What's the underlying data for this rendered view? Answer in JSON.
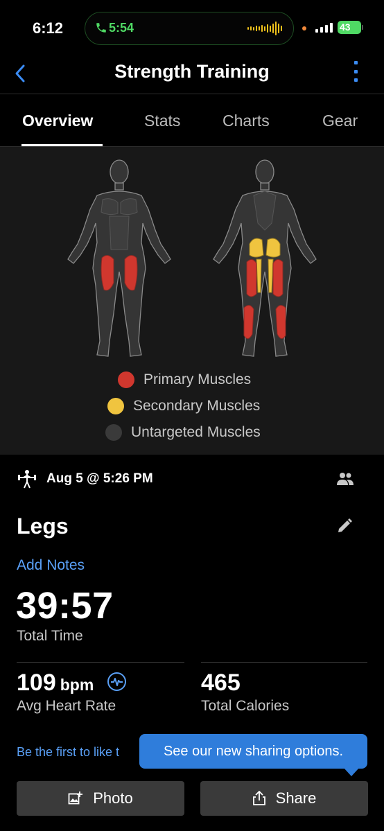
{
  "status_bar": {
    "time": "6:12",
    "call_time": "5:54",
    "battery": "43"
  },
  "nav": {
    "title": "Strength Training",
    "back_icon": "chevron-left-icon",
    "more_icon": "more-vertical-icon",
    "accent_color": "#3b8cf5"
  },
  "tabs": [
    {
      "label": "Overview",
      "active": true
    },
    {
      "label": "Stats",
      "active": false
    },
    {
      "label": "Charts",
      "active": false
    },
    {
      "label": "Gear",
      "active": false
    }
  ],
  "muscle_map": {
    "colors": {
      "primary": "#d0372e",
      "secondary": "#f0c43f",
      "untargeted": "#3a3a3a"
    },
    "legend": [
      {
        "label": "Primary Muscles",
        "color": "#d0372e"
      },
      {
        "label": "Secondary Muscles",
        "color": "#f0c43f"
      },
      {
        "label": "Untargeted Muscles",
        "color": "#3a3a3a"
      }
    ]
  },
  "activity": {
    "icon": "strength-training-icon",
    "date": "Aug 5 @ 5:26 PM",
    "people_icon": "people-icon",
    "name": "Legs",
    "edit_icon": "pencil-icon",
    "add_notes": "Add Notes"
  },
  "summary": {
    "total_time": "39:57",
    "total_time_label": "Total Time",
    "heart_rate_value": "109",
    "heart_rate_unit": "bpm",
    "heart_rate_label": "Avg Heart Rate",
    "calories_value": "465",
    "calories_label": "Total Calories"
  },
  "social": {
    "like_text": "Be the first to like t",
    "tooltip": "See our new sharing options."
  },
  "actions": {
    "photo_label": "Photo",
    "share_label": "Share"
  }
}
